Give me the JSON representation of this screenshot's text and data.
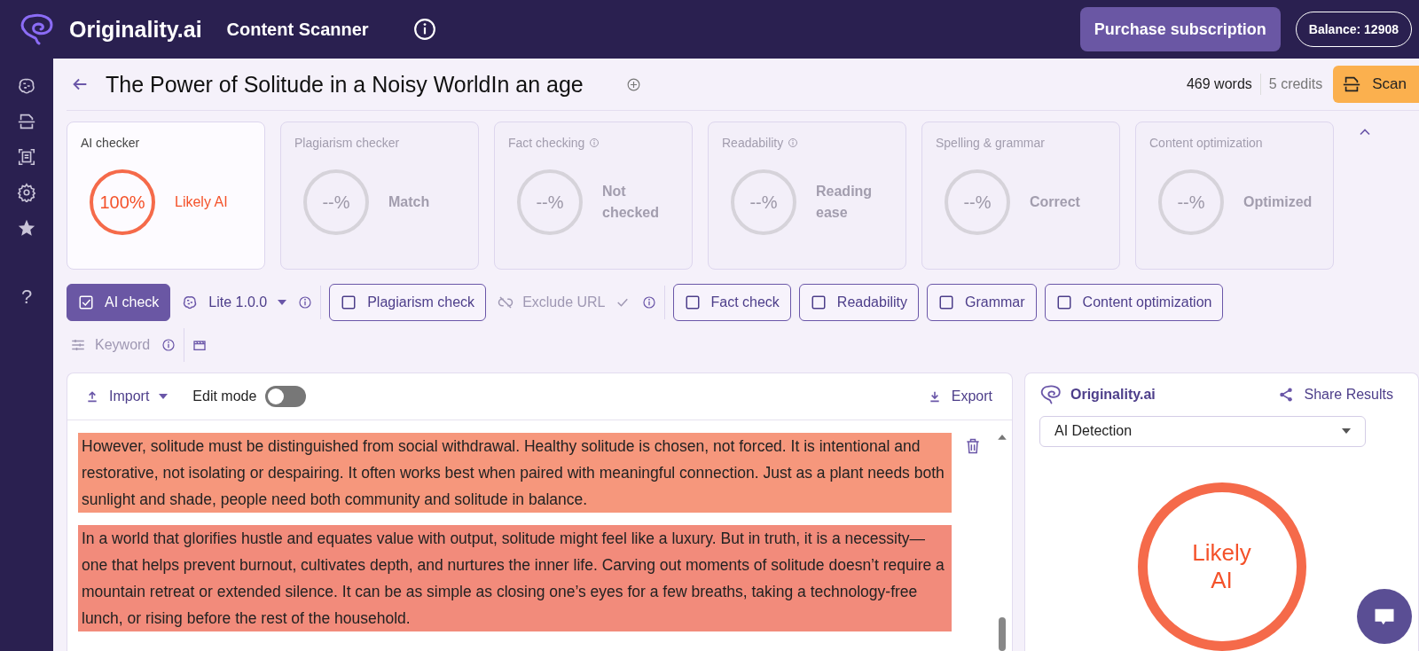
{
  "header": {
    "brand": "Originality.ai",
    "section": "Content Scanner",
    "purchase": "Purchase subscription",
    "balance": "Balance: 12908"
  },
  "sidebar": {
    "items": [
      {
        "kind": "brain",
        "selected": false
      },
      {
        "kind": "scan",
        "selected": false
      },
      {
        "kind": "document",
        "selected": false
      },
      {
        "kind": "gear",
        "selected": false
      },
      {
        "kind": "star",
        "selected": false
      }
    ],
    "help": "?"
  },
  "document": {
    "title": "The Power of Solitude in a Noisy WorldIn an age",
    "words": "469 words",
    "credits": "5 credits",
    "scan": "Scan"
  },
  "cards": [
    {
      "title": "AI checker",
      "info": false,
      "enabled": true,
      "score": "100%",
      "verdict": "Likely AI"
    },
    {
      "title": "Plagiarism checker",
      "info": false,
      "enabled": false,
      "score": "--%",
      "verdict": "Match"
    },
    {
      "title": "Fact checking",
      "info": true,
      "enabled": false,
      "score": "--%",
      "verdict": "Not checked"
    },
    {
      "title": "Readability",
      "info": true,
      "enabled": false,
      "score": "--%",
      "verdict": "Reading ease"
    },
    {
      "title": "Spelling & grammar",
      "info": false,
      "enabled": false,
      "score": "--%",
      "verdict": "Correct"
    },
    {
      "title": "Content optimization",
      "info": false,
      "enabled": false,
      "score": "--%",
      "verdict": "Optimized"
    }
  ],
  "toolbar": [
    {
      "kind": "check",
      "label": "AI check",
      "checked": true
    },
    {
      "kind": "dropdown",
      "label": "Lite 1.0.0"
    },
    {
      "kind": "info"
    },
    {
      "kind": "divider"
    },
    {
      "kind": "check",
      "label": "Plagiarism check",
      "checked": false
    },
    {
      "kind": "url-option",
      "label": "Exclude URL",
      "disabled": true
    },
    {
      "kind": "info"
    },
    {
      "kind": "divider"
    },
    {
      "kind": "check",
      "label": "Fact check",
      "checked": false
    },
    {
      "kind": "check",
      "label": "Readability",
      "checked": false
    },
    {
      "kind": "check",
      "label": "Grammar",
      "checked": false
    },
    {
      "kind": "check",
      "label": "Content optimization",
      "checked": false
    },
    {
      "kind": "keyword-option",
      "label": "Keyword",
      "disabled": true
    },
    {
      "kind": "info"
    },
    {
      "kind": "divider"
    },
    {
      "kind": "film"
    }
  ],
  "editor": {
    "import": "Import",
    "edit_mode": {
      "label": "Edit mode",
      "on": false
    },
    "export": "Export",
    "paragraphs": [
      {
        "text": "However, solitude must be distinguished from social withdrawal.  Healthy solitude is chosen, not forced.  It is intentional and restorative, not isolating or despairing.  It often works best when paired with meaningful connection.  Just as a plant needs both sunlight and shade, people need both community and solitude in balance.",
        "color": "#f6977c"
      },
      {
        "text": "In a world that glorifies hustle and equates value with output, solitude might feel like a luxury.  But in truth, it is a necessity—one that helps prevent burnout, cultivates depth, and nurtures the inner life.  Carving out moments of solitude doesn’t require a mountain retreat or extended silence.  It can be as simple as closing one’s eyes for a few breaths, taking a technology-free lunch, or rising before the rest of the household.",
        "color": "#f28b7b"
      }
    ]
  },
  "results": {
    "brand": "Originality.ai",
    "share": "Share Results",
    "select": "AI Detection",
    "verdict": "Likely AI"
  }
}
